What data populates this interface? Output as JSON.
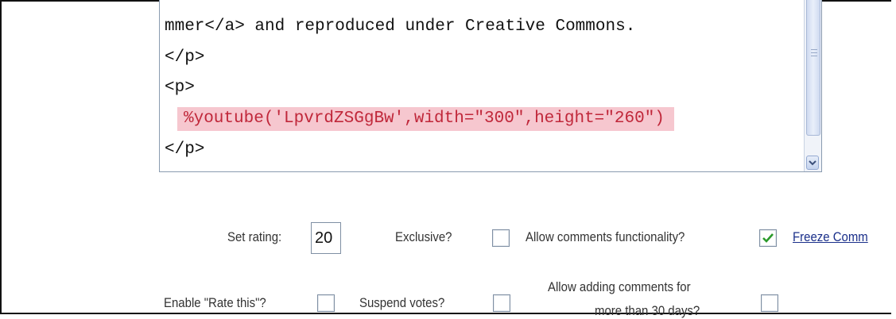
{
  "code_editor": {
    "lines": [
      "mmer</a> and reproduced under Creative Commons.",
      "</p>",
      "<p>",
      "%youtube('LpvrdZSGgBw',width=\"300\",height=\"260\")",
      "</p>"
    ],
    "highlight_color": "#f6c7cf",
    "highlight_text_color": "#c0273a"
  },
  "form": {
    "set_rating_label": "Set rating:",
    "rating_value": "20",
    "exclusive_label": "Exclusive?",
    "allow_comments_label": "Allow comments functionality?",
    "allow_comments_checked": true,
    "freeze_link": "Freeze Comm",
    "enable_rate_label": "Enable \"Rate this\"?",
    "suspend_votes_label": "Suspend votes?",
    "allow_adding_line1": "Allow adding comments for",
    "allow_adding_line2": "more than 30 days?"
  }
}
